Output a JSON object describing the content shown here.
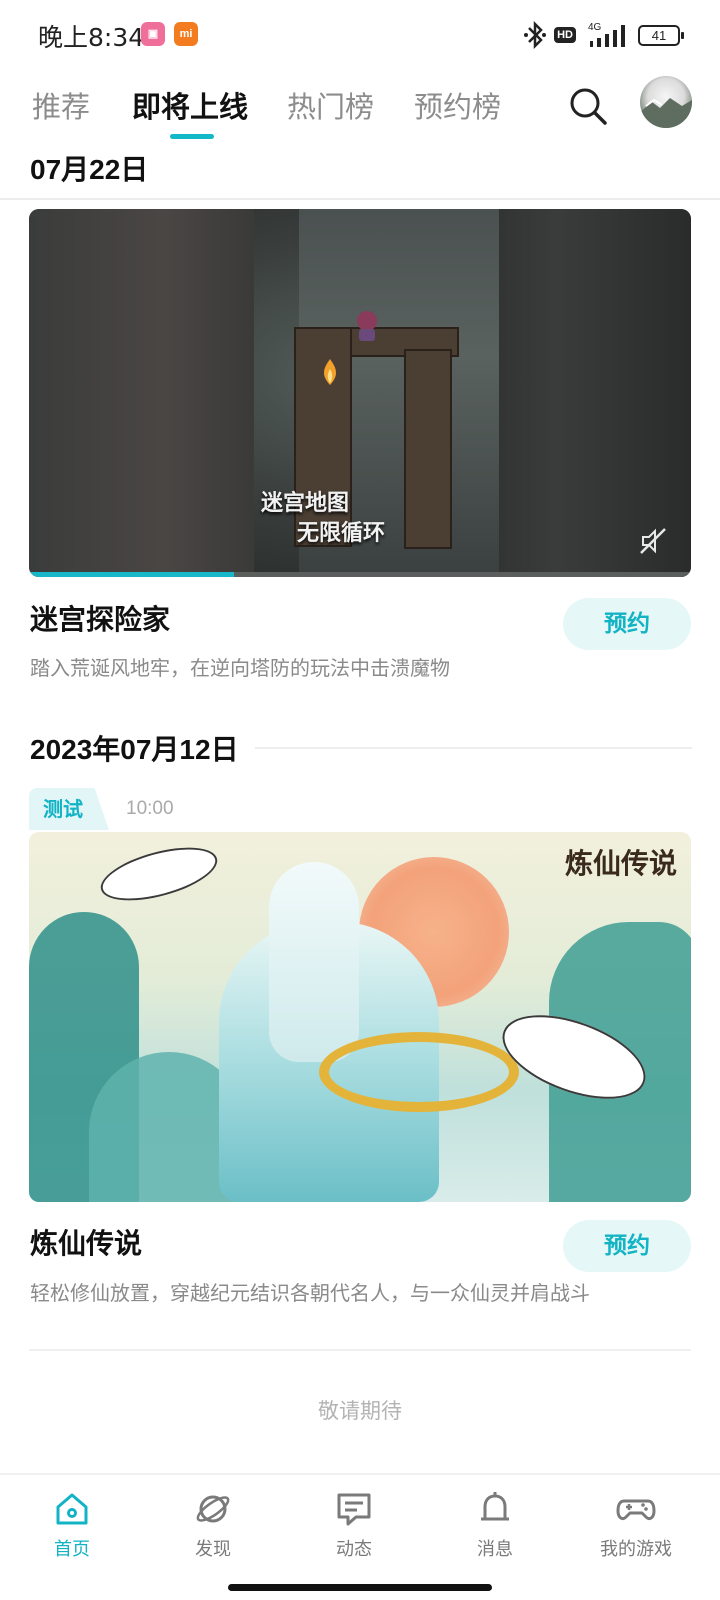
{
  "status_bar": {
    "time": "晚上8:34",
    "hd": "HD",
    "network": "4G",
    "battery": "41",
    "app_icons": [
      "bilibili-icon",
      "mi-icon"
    ],
    "icons": [
      "bluetooth-icon",
      "signal-icon",
      "battery-icon"
    ]
  },
  "top_tabs": {
    "items": [
      {
        "label": "推荐"
      },
      {
        "label": "即将上线"
      },
      {
        "label": "热门榜"
      },
      {
        "label": "预约榜"
      }
    ],
    "active_index": 1,
    "accent": "#14b9c8"
  },
  "sticky_date": "07月22日",
  "games": [
    {
      "title": "迷宫探险家",
      "description": "踏入荒诞风地牢，在逆向塔防的玩法中击溃魔物",
      "button": "预约",
      "video_caption": [
        "迷宫地图",
        "无限循环"
      ],
      "video_progress": 0.31
    },
    {
      "date": "2023年07月12日",
      "tag": "测试",
      "time": "10:00",
      "art_logo": "炼仙传说",
      "title": "炼仙传说",
      "description": "轻松修仙放置，穿越纪元结识各朝代名人，与一众仙灵并肩战斗",
      "button": "预约"
    }
  ],
  "end_text": "敬请期待",
  "bottom_nav": {
    "items": [
      {
        "label": "首页",
        "icon": "home-icon"
      },
      {
        "label": "发现",
        "icon": "discover-planet-icon"
      },
      {
        "label": "动态",
        "icon": "feed-chat-icon"
      },
      {
        "label": "消息",
        "icon": "bell-icon"
      },
      {
        "label": "我的游戏",
        "icon": "gamepad-icon"
      }
    ],
    "active_index": 0
  }
}
